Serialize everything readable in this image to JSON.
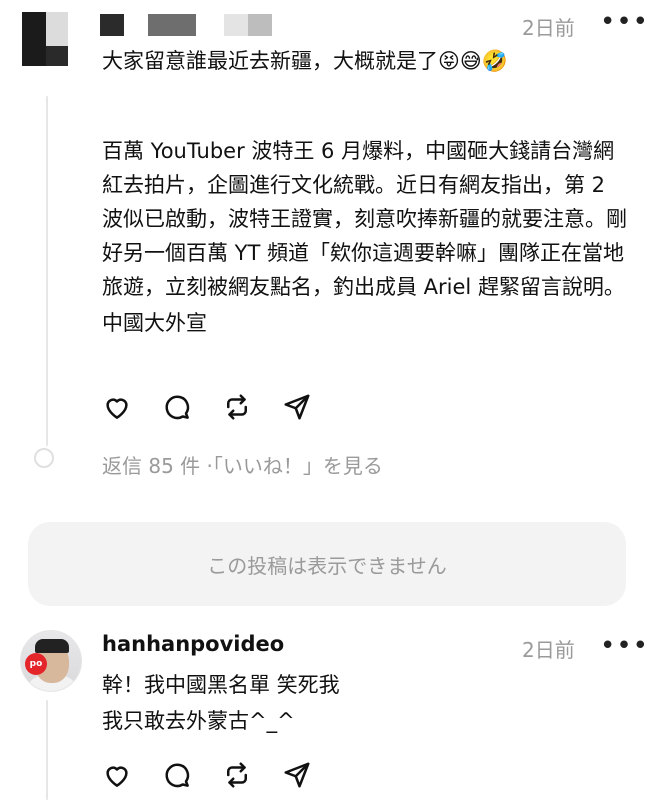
{
  "post1": {
    "timestamp": "2日前",
    "more": "•••",
    "paragraphs": [
      "大家留意誰最近去新疆，大概就是了😝😅🤣",
      "百萬 YouTuber 波特王 6 月爆料，中國砸大錢請台灣網紅去拍片，企圖進行文化統戰。近日有網友指出，第 2 波似已啟動，波特王證實，刻意吹捧新疆的就要注意。剛好另一個百萬 YT 頻道「欸你這週要幹嘛」團隊正在當地旅遊，立刻被網友點名，釣出成員 Ariel 趕緊留言說明。",
      "中國大外宣"
    ],
    "replies_text": "返信 85 件 ·「いいね！」を見る"
  },
  "hidden_notice": "この投稿は表示できません",
  "post2": {
    "username": "hanhanpovideo",
    "timestamp": "2日前",
    "more": "•••",
    "avatar_badge": "po",
    "lines": [
      "幹！我中國黑名單 笑死我",
      "我只敢去外蒙古^_^"
    ]
  },
  "icons": {
    "like": "heart-icon",
    "comment": "comment-icon",
    "repost": "repost-icon",
    "share": "send-icon"
  }
}
